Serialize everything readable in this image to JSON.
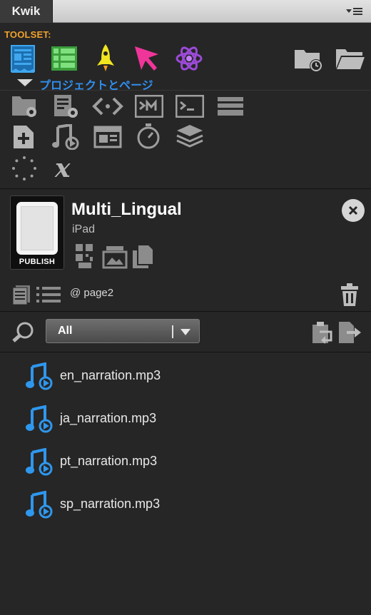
{
  "panel": {
    "tab_title": "Kwik",
    "menu_icon": "panel-menu-icon"
  },
  "toolset": {
    "label": "TOOLSET:",
    "tools": [
      {
        "name": "project-tool-icon",
        "color": "#3fa7ef"
      },
      {
        "name": "list-tool-icon",
        "color": "#4fc84f"
      },
      {
        "name": "rocket-tool-icon",
        "color": "#f2e51f"
      },
      {
        "name": "pointer-tool-icon",
        "color": "#f0359a"
      },
      {
        "name": "atom-tool-icon",
        "color": "#9b4ad8"
      }
    ],
    "right_icons": [
      "folder-clock-icon",
      "folder-icon"
    ],
    "section_label": "プロジェクトとページ",
    "section_label_color": "#2f8ff0"
  },
  "tool_grid": {
    "rows": [
      [
        "folder-gear-icon",
        "document-gear-icon",
        "code-brackets-icon",
        "terminal-m-icon",
        "terminal-prompt-icon",
        "stack-layers-icon"
      ],
      [
        "add-page-icon",
        "music-note-icon",
        "widget-icon",
        "stopwatch-icon",
        "layers-icon"
      ],
      [
        "dotted-circle-icon",
        "variable-x-icon"
      ]
    ]
  },
  "project": {
    "title": "Multi_Lingual",
    "device": "iPad",
    "publish_label": "PUBLISH",
    "action_icons": [
      "qr-code-icon",
      "image-icon",
      "copy-icon"
    ]
  },
  "page": {
    "label": "@ page2",
    "icons": [
      "pages-icon",
      "list-icon",
      "trash-icon"
    ]
  },
  "filter": {
    "selected": "All",
    "icons": [
      "search-icon",
      "paste-icon",
      "export-icon"
    ]
  },
  "files": [
    {
      "name": "en_narration.mp3",
      "icon": "audio-file-icon"
    },
    {
      "name": "ja_narration.mp3",
      "icon": "audio-file-icon"
    },
    {
      "name": "pt_narration.mp3",
      "icon": "audio-file-icon"
    },
    {
      "name": "sp_narration.mp3",
      "icon": "audio-file-icon"
    }
  ],
  "colors": {
    "panel_bg": "#262626",
    "toolset_label": "#f2a22c",
    "audio_icon": "#2f97ee"
  }
}
